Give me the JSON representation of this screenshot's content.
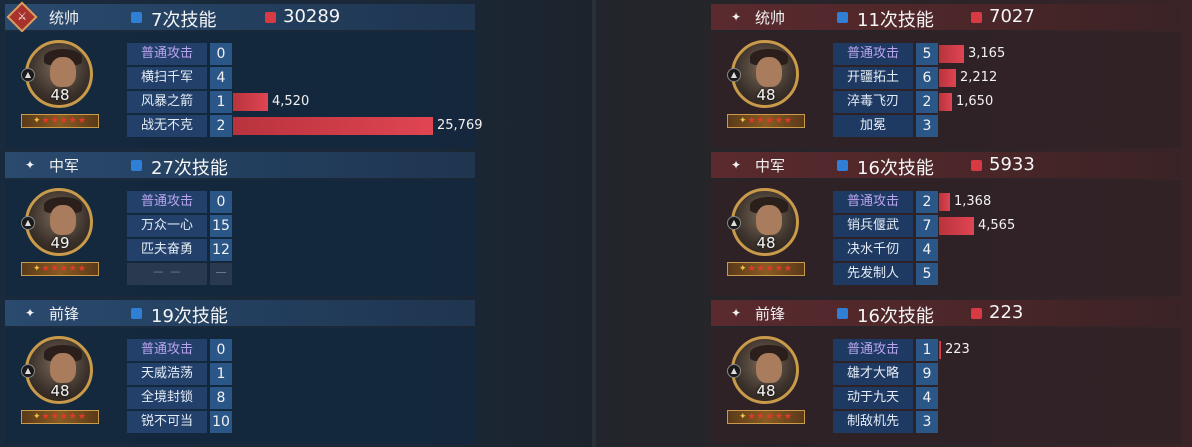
{
  "left": {
    "panels": [
      {
        "role": "统帅",
        "skill_count": "7次技能",
        "damage": "30289",
        "level": "48",
        "skills": [
          {
            "name": "普通攻击",
            "count": "0",
            "value": "",
            "fraction": 0,
            "normal": true
          },
          {
            "name": "横扫千军",
            "count": "4",
            "value": "",
            "fraction": 0
          },
          {
            "name": "风暴之箭",
            "count": "1",
            "value": "4,520",
            "fraction": 0.175
          },
          {
            "name": "战无不克",
            "count": "2",
            "value": "25,769",
            "fraction": 1.0
          }
        ]
      },
      {
        "role": "中军",
        "skill_count": "27次技能",
        "damage": "",
        "level": "49",
        "skills": [
          {
            "name": "普通攻击",
            "count": "0",
            "value": "",
            "fraction": 0,
            "normal": true
          },
          {
            "name": "万众一心",
            "count": "15",
            "value": "",
            "fraction": 0
          },
          {
            "name": "匹夫奋勇",
            "count": "12",
            "value": "",
            "fraction": 0
          },
          {
            "name": "－ －",
            "count": "－",
            "value": "",
            "fraction": 0,
            "dash": true
          }
        ]
      },
      {
        "role": "前锋",
        "skill_count": "19次技能",
        "damage": "",
        "level": "48",
        "skills": [
          {
            "name": "普通攻击",
            "count": "0",
            "value": "",
            "fraction": 0,
            "normal": true
          },
          {
            "name": "天威浩荡",
            "count": "1",
            "value": "",
            "fraction": 0
          },
          {
            "name": "全境封锁",
            "count": "8",
            "value": "",
            "fraction": 0
          },
          {
            "name": "锐不可当",
            "count": "10",
            "value": "",
            "fraction": 0
          }
        ]
      }
    ]
  },
  "right": {
    "panels": [
      {
        "role": "统帅",
        "skill_count": "11次技能",
        "damage": "7027",
        "level": "48",
        "skills": [
          {
            "name": "普通攻击",
            "count": "5",
            "value": "3,165",
            "fraction": 0.123,
            "normal": true
          },
          {
            "name": "开疆拓土",
            "count": "6",
            "value": "2,212",
            "fraction": 0.086
          },
          {
            "name": "淬毒飞刃",
            "count": "2",
            "value": "1,650",
            "fraction": 0.064
          },
          {
            "name": "加冕",
            "count": "3",
            "value": "",
            "fraction": 0
          }
        ]
      },
      {
        "role": "中军",
        "skill_count": "16次技能",
        "damage": "5933",
        "level": "48",
        "skills": [
          {
            "name": "普通攻击",
            "count": "2",
            "value": "1,368",
            "fraction": 0.053,
            "normal": true
          },
          {
            "name": "销兵偃武",
            "count": "7",
            "value": "4,565",
            "fraction": 0.177
          },
          {
            "name": "决水千仞",
            "count": "4",
            "value": "",
            "fraction": 0
          },
          {
            "name": "先发制人",
            "count": "5",
            "value": "",
            "fraction": 0
          }
        ]
      },
      {
        "role": "前锋",
        "skill_count": "16次技能",
        "damage": "223",
        "level": "48",
        "skills": [
          {
            "name": "普通攻击",
            "count": "1",
            "value": "223",
            "fraction": 0.009,
            "normal": true
          },
          {
            "name": "雄才大略",
            "count": "9",
            "value": "",
            "fraction": 0
          },
          {
            "name": "动于九天",
            "count": "4",
            "value": "",
            "fraction": 0
          },
          {
            "name": "制敌机先",
            "count": "3",
            "value": "",
            "fraction": 0
          }
        ]
      }
    ]
  },
  "stars": "★★★★★",
  "colors": {
    "left_accent": "#2f7fd6",
    "right_accent": "#d73a42",
    "bar": "#e04552"
  },
  "icons": {
    "role": "sparkle-icon",
    "commander_badge": "sword-badge-icon",
    "camp": "camp-icon"
  }
}
